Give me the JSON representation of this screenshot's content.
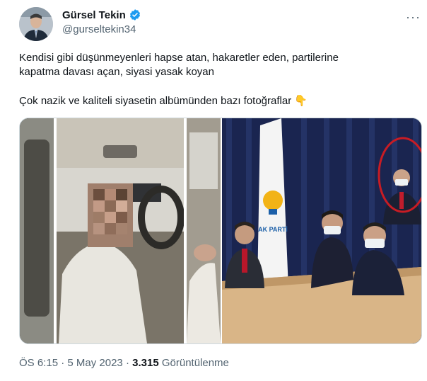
{
  "author": {
    "name": "Gürsel Tekin",
    "handle": "@gurselteki n34",
    "verified_icon": "verified-badge-icon"
  },
  "more_icon": "···",
  "tweet": {
    "line1": "Kendisi gibi düşünmeyenleri hapse atan, hakaretler eden, partilerine",
    "line2": "kapatma davası açan, siyasi yasak koyan",
    "line3": "Çok nazik ve kaliteli siyasetin albümünden bazı fotoğraflar 👇"
  },
  "media": {
    "party_label": "AK PARTİ"
  },
  "meta": {
    "time": "ÖS 6:15",
    "sep": "·",
    "date": "5 May 2023",
    "views_count": "3.315",
    "views_label": "Görüntülenme"
  },
  "colors": {
    "accent": "#1d9bf0",
    "muted": "#536471"
  }
}
